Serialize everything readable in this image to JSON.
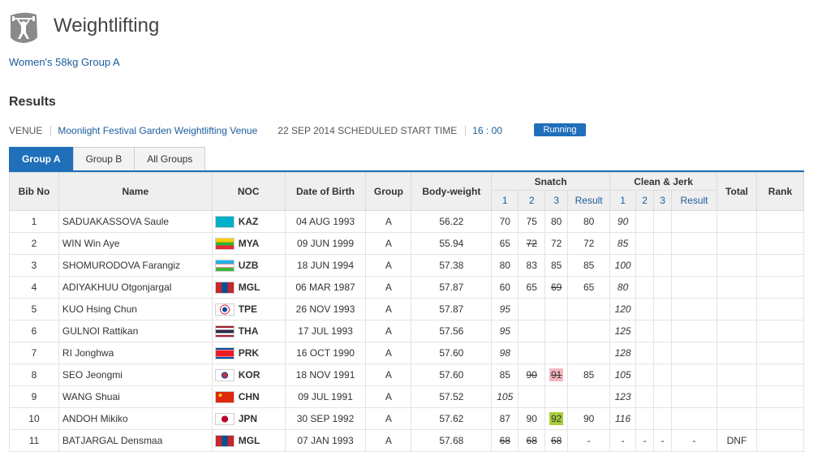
{
  "app": {
    "title": "Weightlifting"
  },
  "event": {
    "name": "Women's 58kg Group A"
  },
  "section": {
    "title": "Results"
  },
  "venue": {
    "label": "VENUE",
    "name": "Moonlight Festival Garden Weightlifting Venue",
    "date_label": "22 SEP 2014 SCHEDULED START TIME",
    "time": "16 : 00",
    "status": "Running"
  },
  "tabs": [
    {
      "label": "Group A"
    },
    {
      "label": "Group B"
    },
    {
      "label": "All Groups"
    }
  ],
  "table": {
    "headers": {
      "bib": "Bib No",
      "name": "Name",
      "noc": "NOC",
      "dob": "Date of Birth",
      "group": "Group",
      "bw": "Body-weight",
      "snatch": "Snatch",
      "cj": "Clean & Jerk",
      "total": "Total",
      "rank": "Rank",
      "a1": "1",
      "a2": "2",
      "a3": "3",
      "result": "Result"
    },
    "rows": [
      {
        "bib": "1",
        "name": "SADUAKASSOVA Saule",
        "noc": "KAZ",
        "dob": "04 AUG 1993",
        "group": "A",
        "bw": "56.22",
        "s1": "70",
        "s2": "75",
        "s3": "80",
        "sr": "80",
        "c1": "90",
        "c2": "",
        "c3": "",
        "cr": "",
        "total": "",
        "rank": ""
      },
      {
        "bib": "2",
        "name": "WIN Win Aye",
        "noc": "MYA",
        "dob": "09 JUN 1999",
        "group": "A",
        "bw": "55.94",
        "s1": "65",
        "s2": "72",
        "s3": "72",
        "sr": "72",
        "c1": "85",
        "c2": "",
        "c3": "",
        "cr": "",
        "total": "",
        "rank": ""
      },
      {
        "bib": "3",
        "name": "SHOMURODOVA Farangiz",
        "noc": "UZB",
        "dob": "18 JUN 1994",
        "group": "A",
        "bw": "57.38",
        "s1": "80",
        "s2": "83",
        "s3": "85",
        "sr": "85",
        "c1": "100",
        "c2": "",
        "c3": "",
        "cr": "",
        "total": "",
        "rank": ""
      },
      {
        "bib": "4",
        "name": "ADIYAKHUU Otgonjargal",
        "noc": "MGL",
        "dob": "06 MAR 1987",
        "group": "A",
        "bw": "57.87",
        "s1": "60",
        "s2": "65",
        "s3": "69",
        "sr": "65",
        "c1": "80",
        "c2": "",
        "c3": "",
        "cr": "",
        "total": "",
        "rank": ""
      },
      {
        "bib": "5",
        "name": "KUO Hsing Chun",
        "noc": "TPE",
        "dob": "26 NOV 1993",
        "group": "A",
        "bw": "57.87",
        "s1": "95",
        "s2": "",
        "s3": "",
        "sr": "",
        "c1": "120",
        "c2": "",
        "c3": "",
        "cr": "",
        "total": "",
        "rank": ""
      },
      {
        "bib": "6",
        "name": "GULNOI Rattikan",
        "noc": "THA",
        "dob": "17 JUL 1993",
        "group": "A",
        "bw": "57.56",
        "s1": "95",
        "s2": "",
        "s3": "",
        "sr": "",
        "c1": "125",
        "c2": "",
        "c3": "",
        "cr": "",
        "total": "",
        "rank": ""
      },
      {
        "bib": "7",
        "name": "RI Jonghwa",
        "noc": "PRK",
        "dob": "16 OCT 1990",
        "group": "A",
        "bw": "57.60",
        "s1": "98",
        "s2": "",
        "s3": "",
        "sr": "",
        "c1": "128",
        "c2": "",
        "c3": "",
        "cr": "",
        "total": "",
        "rank": ""
      },
      {
        "bib": "8",
        "name": "SEO Jeongmi",
        "noc": "KOR",
        "dob": "18 NOV 1991",
        "group": "A",
        "bw": "57.60",
        "s1": "85",
        "s2": "90",
        "s3": "91",
        "sr": "85",
        "c1": "105",
        "c2": "",
        "c3": "",
        "cr": "",
        "total": "",
        "rank": ""
      },
      {
        "bib": "9",
        "name": "WANG Shuai",
        "noc": "CHN",
        "dob": "09 JUL 1991",
        "group": "A",
        "bw": "57.52",
        "s1": "105",
        "s2": "",
        "s3": "",
        "sr": "",
        "c1": "123",
        "c2": "",
        "c3": "",
        "cr": "",
        "total": "",
        "rank": ""
      },
      {
        "bib": "10",
        "name": "ANDOH Mikiko",
        "noc": "JPN",
        "dob": "30 SEP 1992",
        "group": "A",
        "bw": "57.62",
        "s1": "87",
        "s2": "90",
        "s3": "92",
        "sr": "90",
        "c1": "116",
        "c2": "",
        "c3": "",
        "cr": "",
        "total": "",
        "rank": ""
      },
      {
        "bib": "11",
        "name": "BATJARGAL Densmaa",
        "noc": "MGL",
        "dob": "07 JAN 1993",
        "group": "A",
        "bw": "57.68",
        "s1": "68",
        "s2": "68",
        "s3": "68",
        "sr": "-",
        "c1": "-",
        "c2": "-",
        "c3": "-",
        "cr": "-",
        "total": "DNF",
        "rank": ""
      }
    ]
  }
}
